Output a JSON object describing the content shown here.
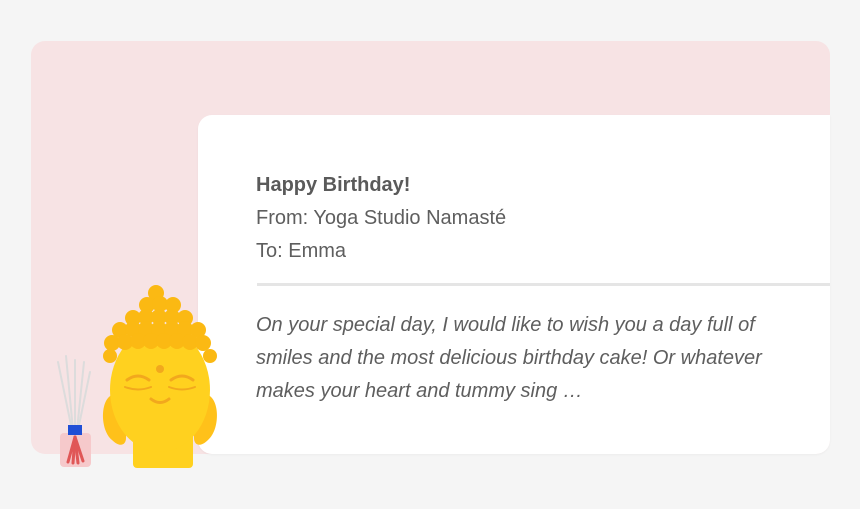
{
  "email": {
    "subject": "Happy Birthday!",
    "from": "From: Yoga Studio Namasté",
    "to": "To: Emma",
    "body": "On your special day, I would like to wish you a day full of smiles and the most delicious birthday cake! Or whatever makes your heart and tummy sing …"
  },
  "colors": {
    "background": "#f5f5f5",
    "panel_pink": "#f7e3e4",
    "card": "#ffffff",
    "text": "#5e5e5e",
    "buddha_yellow": "#ffd11f",
    "buddha_hair": "#fbb913",
    "diffuser_cap": "#1f4fd6",
    "diffuser_reeds": "#e05757"
  },
  "icons": [
    "buddha-illustration",
    "reed-diffuser-illustration"
  ]
}
